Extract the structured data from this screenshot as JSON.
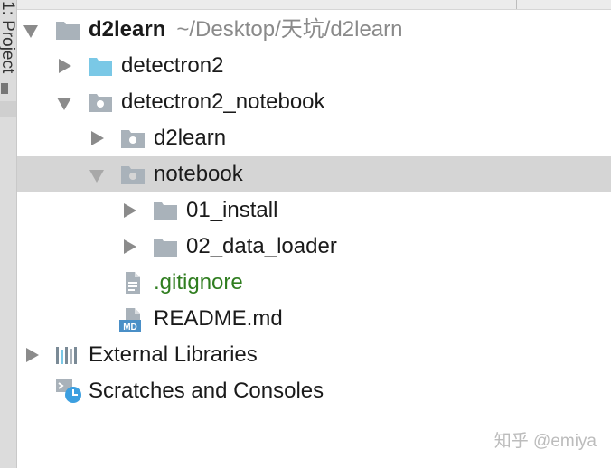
{
  "side_panel": {
    "label": "1: Project"
  },
  "tree": {
    "root": {
      "label": "d2learn",
      "path": "~/Desktop/天坑/d2learn",
      "expanded": true
    },
    "items": [
      {
        "label": "detectron2",
        "kind": "folder",
        "icon": "folder-blue-icon",
        "expanded": false
      },
      {
        "label": "detectron2_notebook",
        "kind": "folder",
        "icon": "folder-icon",
        "expanded": true
      },
      {
        "label": "d2learn",
        "kind": "folder",
        "icon": "folder-icon",
        "expanded": false
      },
      {
        "label": "notebook",
        "kind": "folder",
        "icon": "folder-icon",
        "expanded": true,
        "selected": true
      },
      {
        "label": "01_install",
        "kind": "folder",
        "icon": "folder-icon",
        "expanded": false
      },
      {
        "label": "02_data_loader",
        "kind": "folder",
        "icon": "folder-icon",
        "expanded": false
      },
      {
        "label": ".gitignore",
        "kind": "file",
        "icon": "text-file-icon",
        "color": "#2f7d1f"
      },
      {
        "label": "README.md",
        "kind": "file",
        "icon": "markdown-file-icon"
      }
    ],
    "external_libraries": {
      "label": "External Libraries",
      "icon": "libraries-icon",
      "expanded": false
    },
    "scratches": {
      "label": "Scratches and Consoles",
      "icon": "scratches-icon"
    }
  },
  "watermark": {
    "text": "知乎 @emiya"
  },
  "colors": {
    "selection": "#d5d5d5",
    "folder": "#a9b2ba",
    "folder_blue": "#7ac8e6",
    "gitignore_text": "#2f7d1f",
    "path_hint": "#8a8a8a"
  }
}
